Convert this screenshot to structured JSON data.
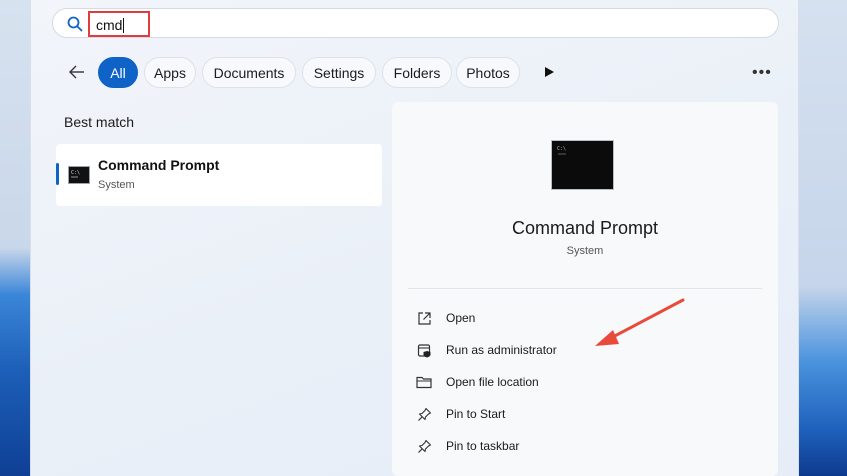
{
  "search": {
    "query": "cmd"
  },
  "filters": [
    {
      "label": "All",
      "active": true
    },
    {
      "label": "Apps",
      "active": false
    },
    {
      "label": "Documents",
      "active": false
    },
    {
      "label": "Settings",
      "active": false
    },
    {
      "label": "Folders",
      "active": false
    },
    {
      "label": "Photos",
      "active": false
    }
  ],
  "best_match": {
    "heading": "Best match",
    "name": "Command Prompt",
    "type": "System"
  },
  "detail": {
    "name": "Command Prompt",
    "type": "System",
    "actions": [
      {
        "label": "Open",
        "icon": "open-external-icon"
      },
      {
        "label": "Run as administrator",
        "icon": "shield-admin-icon"
      },
      {
        "label": "Open file location",
        "icon": "folder-icon"
      },
      {
        "label": "Pin to Start",
        "icon": "pin-icon"
      },
      {
        "label": "Pin to taskbar",
        "icon": "pin-icon"
      }
    ]
  },
  "colors": {
    "accent": "#0f63c6",
    "annotation": "#e23b3b"
  }
}
